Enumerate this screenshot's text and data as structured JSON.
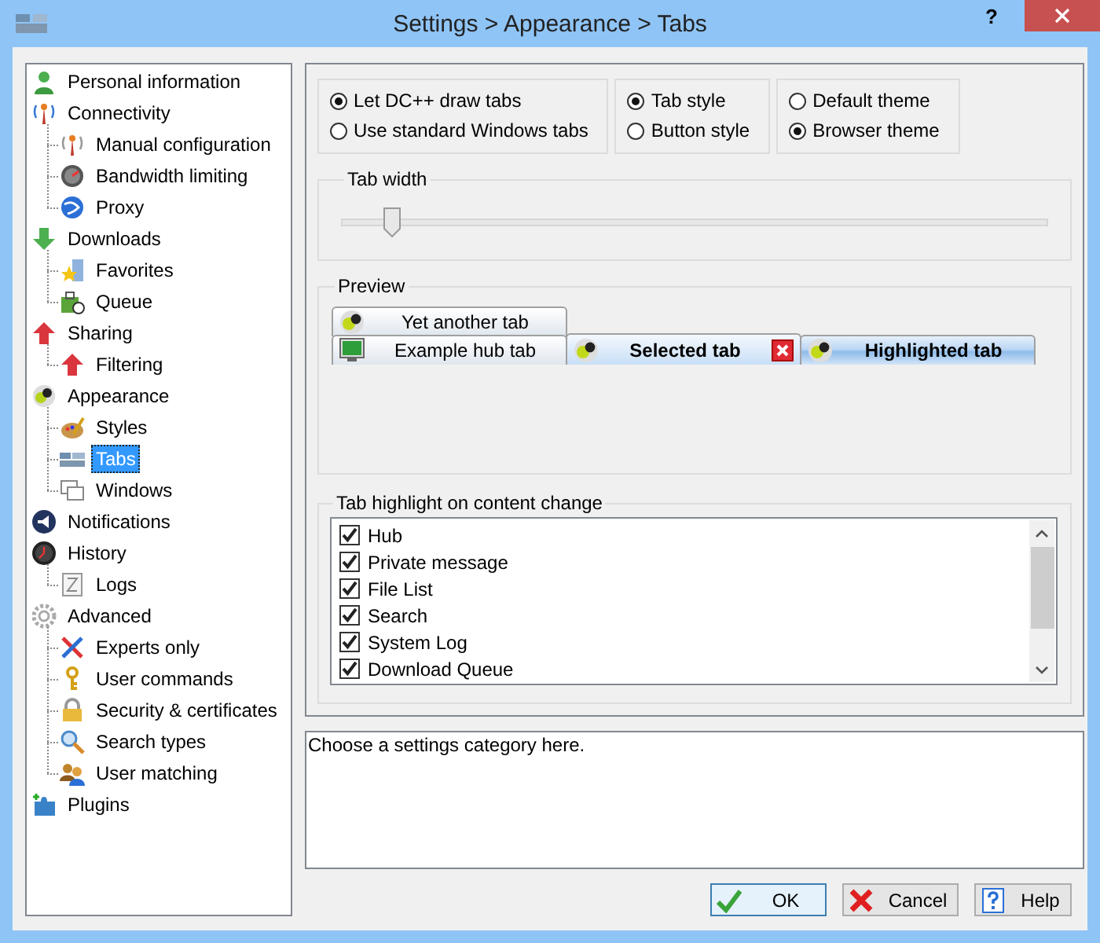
{
  "window": {
    "title": "Settings > Appearance > Tabs",
    "help_button": "?"
  },
  "sidebar": {
    "items": [
      {
        "label": "Personal information",
        "selected": false
      },
      {
        "label": "Connectivity",
        "selected": false,
        "children": [
          {
            "label": "Manual configuration",
            "selected": false
          },
          {
            "label": "Bandwidth limiting",
            "selected": false
          },
          {
            "label": "Proxy",
            "selected": false
          }
        ]
      },
      {
        "label": "Downloads",
        "selected": false,
        "children": [
          {
            "label": "Favorites",
            "selected": false
          },
          {
            "label": "Queue",
            "selected": false
          }
        ]
      },
      {
        "label": "Sharing",
        "selected": false,
        "children": [
          {
            "label": "Filtering",
            "selected": false
          }
        ]
      },
      {
        "label": "Appearance",
        "selected": false,
        "children": [
          {
            "label": "Styles",
            "selected": false
          },
          {
            "label": "Tabs",
            "selected": true
          },
          {
            "label": "Windows",
            "selected": false
          }
        ]
      },
      {
        "label": "Notifications",
        "selected": false
      },
      {
        "label": "History",
        "selected": false,
        "children": [
          {
            "label": "Logs",
            "selected": false
          }
        ]
      },
      {
        "label": "Advanced",
        "selected": false,
        "children": [
          {
            "label": "Experts only",
            "selected": false
          },
          {
            "label": "User commands",
            "selected": false
          },
          {
            "label": "Security & certificates",
            "selected": false
          },
          {
            "label": "Search types",
            "selected": false
          },
          {
            "label": "User matching",
            "selected": false
          }
        ]
      },
      {
        "label": "Plugins",
        "selected": false
      }
    ]
  },
  "radio_groups": [
    {
      "options": [
        {
          "label": "Let DC++ draw tabs",
          "selected": true
        },
        {
          "label": "Use standard Windows tabs",
          "selected": false
        }
      ]
    },
    {
      "options": [
        {
          "label": "Tab style",
          "selected": true
        },
        {
          "label": "Button style",
          "selected": false
        }
      ]
    },
    {
      "options": [
        {
          "label": "Default theme",
          "selected": false
        },
        {
          "label": "Browser theme",
          "selected": true
        }
      ]
    }
  ],
  "tab_width": {
    "title": "Tab width",
    "level": 0.07
  },
  "preview": {
    "title": "Preview",
    "rows": [
      [
        {
          "label": "Yet another tab",
          "kind": "window",
          "selected": false,
          "highlighted": false
        }
      ],
      [
        {
          "label": "Example hub tab",
          "kind": "hub",
          "selected": false,
          "highlighted": false
        },
        {
          "label": "Selected tab",
          "kind": "window",
          "selected": true,
          "highlighted": false
        },
        {
          "label": "Highlighted tab",
          "kind": "window",
          "selected": false,
          "highlighted": true
        }
      ]
    ]
  },
  "highlight": {
    "title": "Tab highlight on content change",
    "items": [
      {
        "label": "Hub",
        "checked": true
      },
      {
        "label": "Private message",
        "checked": true
      },
      {
        "label": "File List",
        "checked": true
      },
      {
        "label": "Search",
        "checked": true
      },
      {
        "label": "System Log",
        "checked": true
      },
      {
        "label": "Download Queue",
        "checked": true
      }
    ]
  },
  "description": "Choose a settings category here.",
  "buttons": [
    {
      "label": "OK",
      "kind": "ok",
      "focused": true
    },
    {
      "label": "Cancel",
      "kind": "cancel",
      "focused": false
    },
    {
      "label": "Help",
      "kind": "help",
      "focused": false
    }
  ]
}
